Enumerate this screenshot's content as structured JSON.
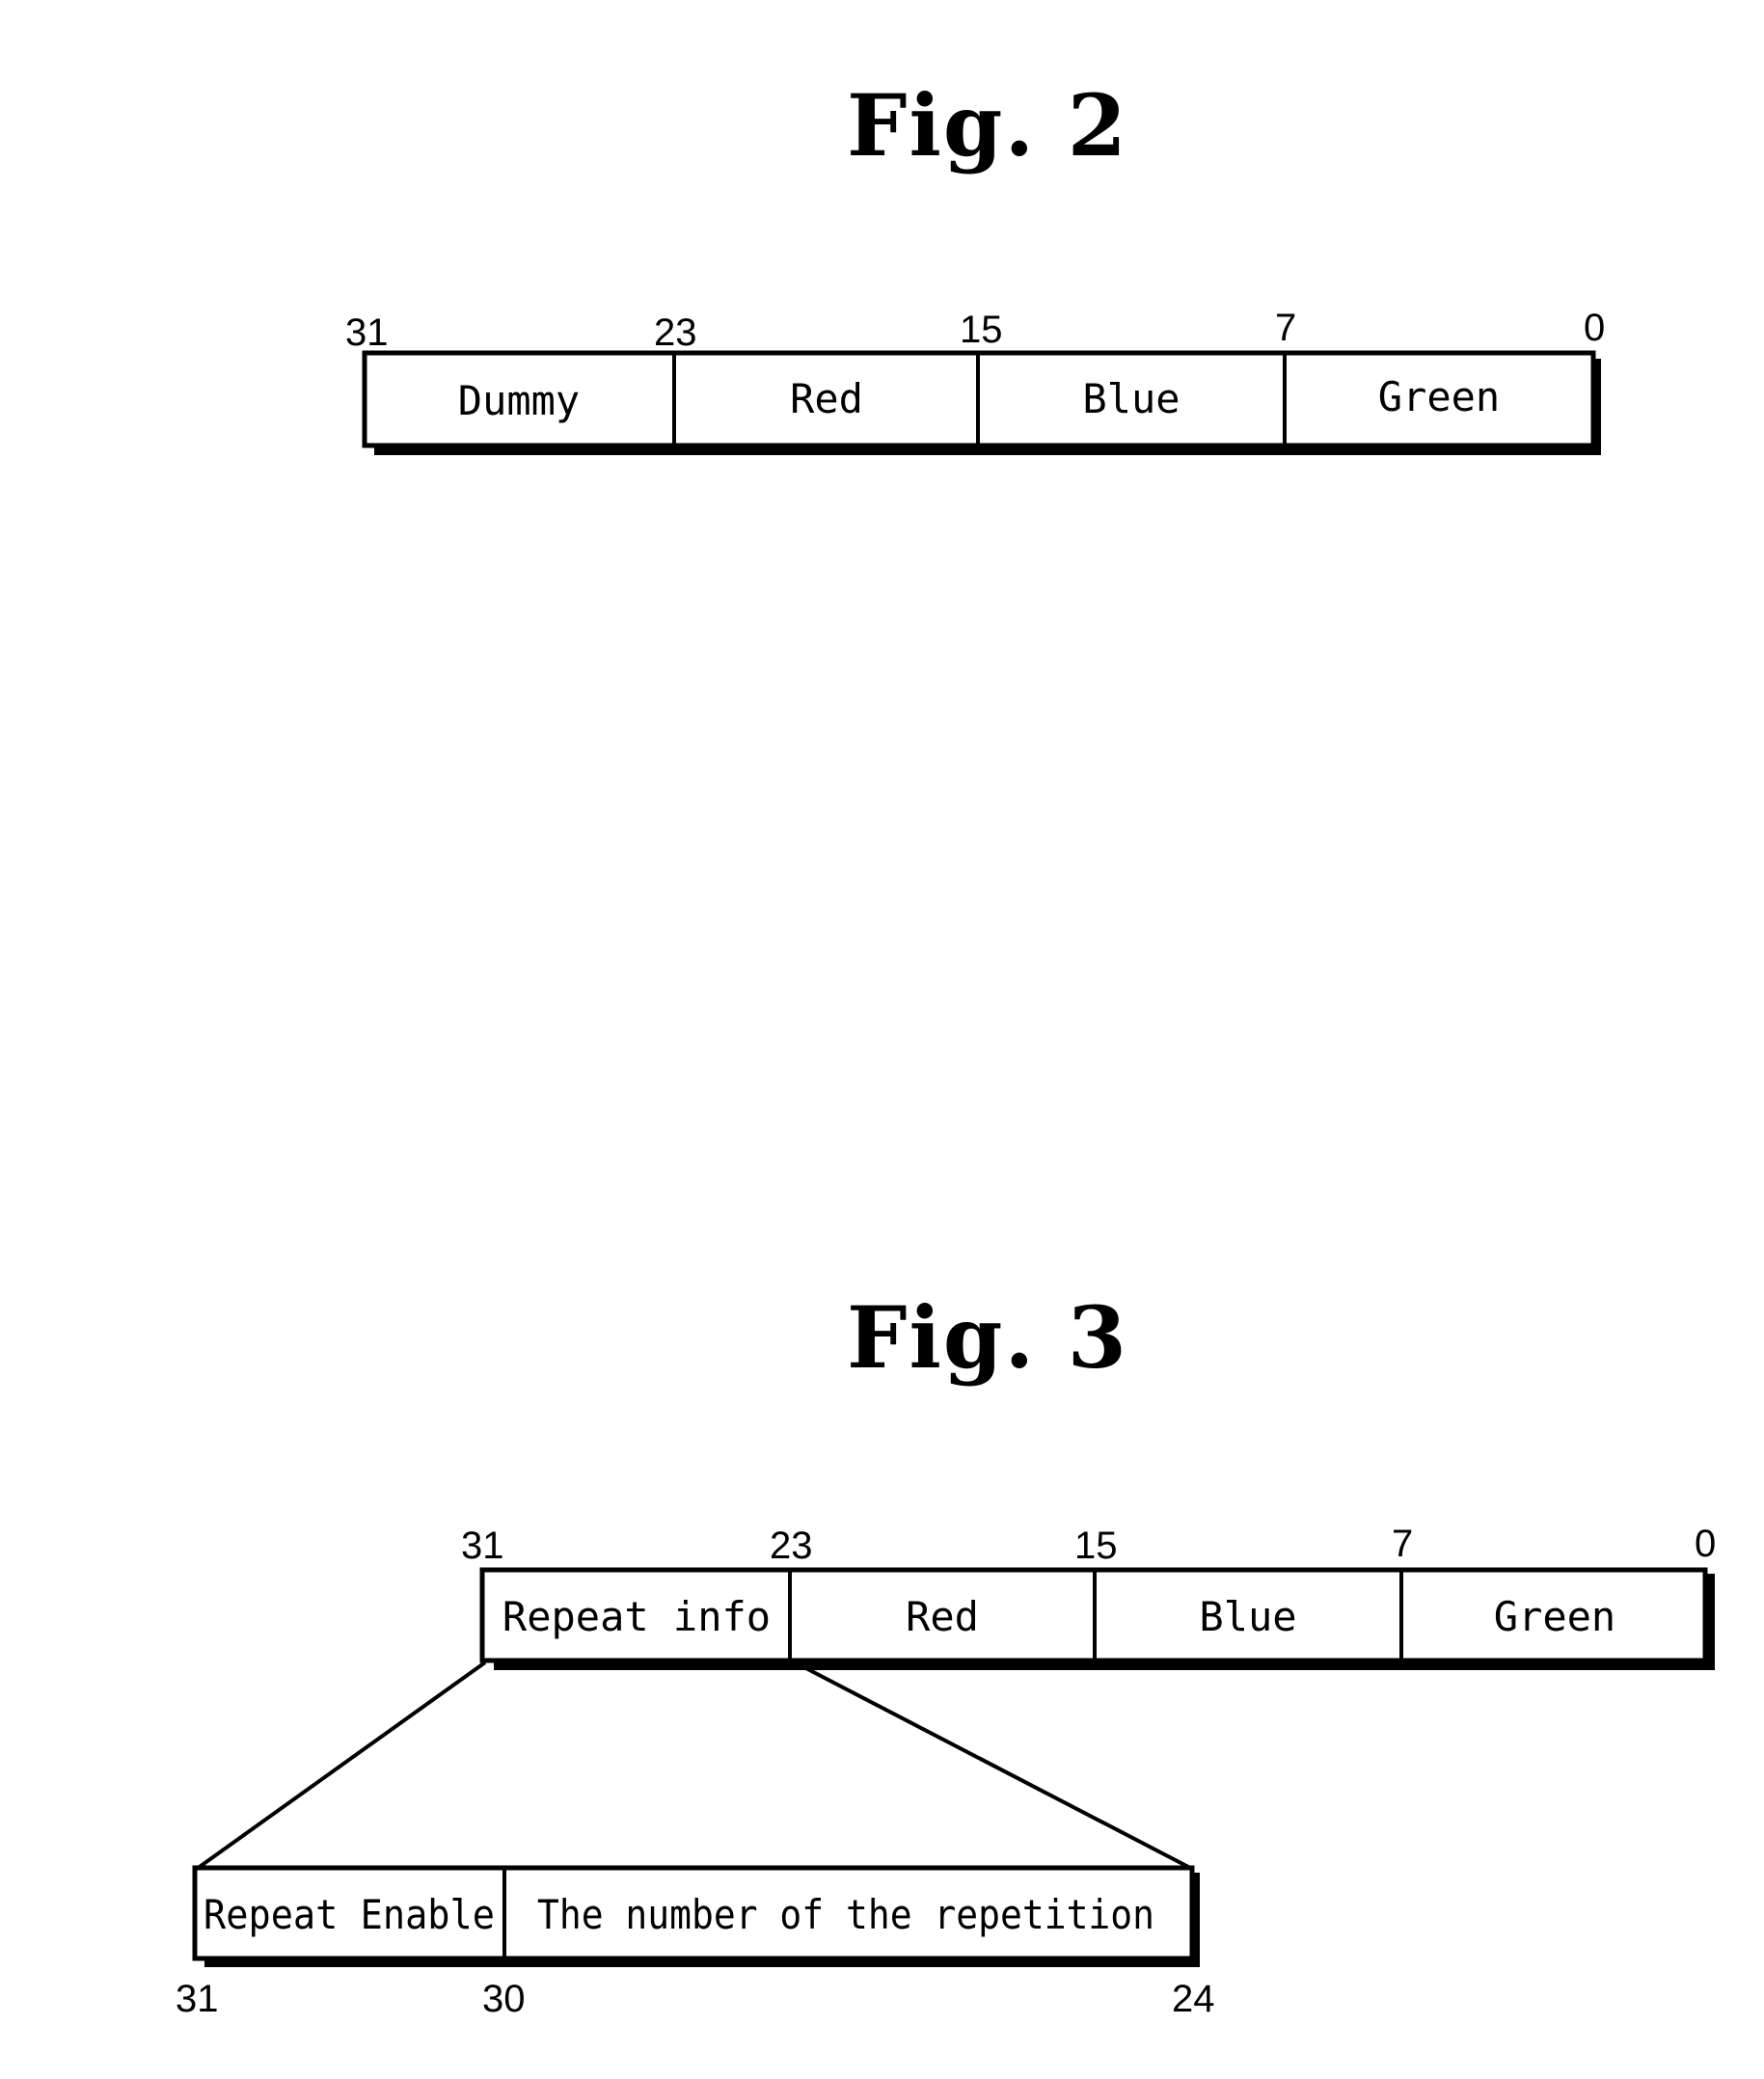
{
  "fig2": {
    "title": "Fig. 2",
    "bit_labels": [
      "31",
      "23",
      "15",
      "7",
      "0"
    ],
    "fields": [
      "Dummy",
      "Red",
      "Blue",
      "Green"
    ]
  },
  "fig3": {
    "title": "Fig. 3",
    "bit_labels": [
      "31",
      "23",
      "15",
      "7",
      "0"
    ],
    "fields": [
      "Repeat info",
      "Red",
      "Blue",
      "Green"
    ],
    "expanded": {
      "fields": [
        "Repeat Enable",
        "The number of the repetition"
      ],
      "bit_labels": [
        "31",
        "30",
        "24"
      ]
    }
  }
}
